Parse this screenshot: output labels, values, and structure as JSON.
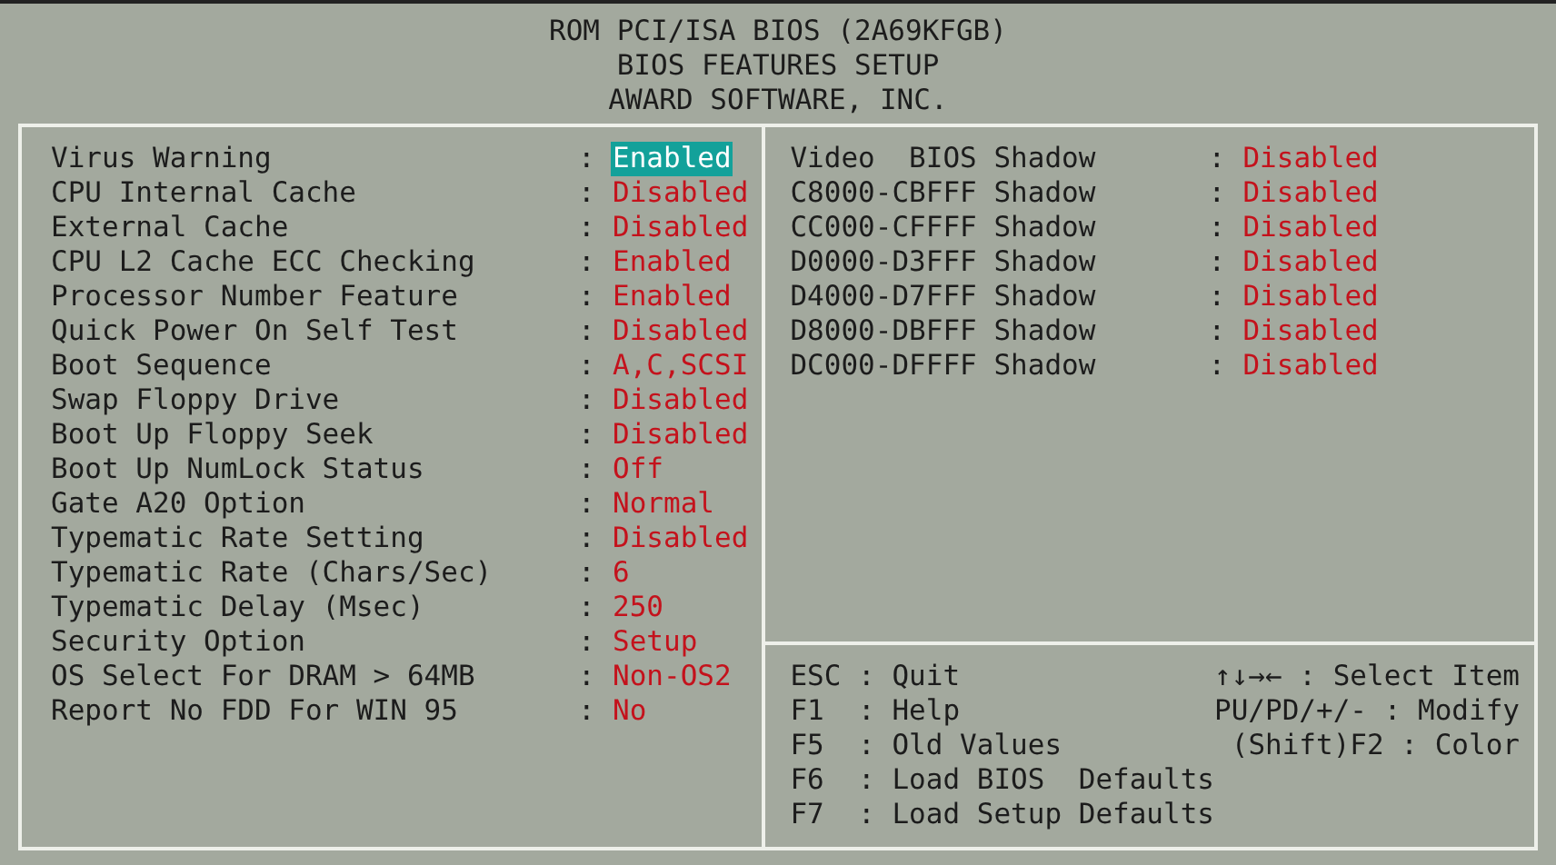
{
  "header": [
    "ROM PCI/ISA BIOS (2A69KFGB)",
    "BIOS FEATURES SETUP",
    "AWARD SOFTWARE, INC."
  ],
  "settings": [
    {
      "label": "Virus Warning",
      "separator": ":",
      "value": "Enabled",
      "selected": true
    },
    {
      "label": "CPU Internal Cache",
      "separator": ":",
      "value": "Disabled",
      "selected": false
    },
    {
      "label": "External Cache",
      "separator": ":",
      "value": "Disabled",
      "selected": false
    },
    {
      "label": "CPU L2 Cache ECC Checking",
      "separator": ":",
      "value": "Enabled",
      "selected": false
    },
    {
      "label": "Processor Number Feature",
      "separator": ":",
      "value": "Enabled",
      "selected": false
    },
    {
      "label": "Quick Power On Self Test",
      "separator": ":",
      "value": "Disabled",
      "selected": false
    },
    {
      "label": "Boot Sequence",
      "separator": ":",
      "value": "A,C,SCSI",
      "selected": false
    },
    {
      "label": "Swap Floppy Drive",
      "separator": ":",
      "value": "Disabled",
      "selected": false
    },
    {
      "label": "Boot Up Floppy Seek",
      "separator": ":",
      "value": "Disabled",
      "selected": false
    },
    {
      "label": "Boot Up NumLock Status",
      "separator": ":",
      "value": "Off",
      "selected": false
    },
    {
      "label": "Gate A20 Option",
      "separator": ":",
      "value": "Normal",
      "selected": false
    },
    {
      "label": "Typematic Rate Setting",
      "separator": ":",
      "value": "Disabled",
      "selected": false
    },
    {
      "label": "Typematic Rate (Chars/Sec)",
      "separator": ":",
      "value": "6",
      "selected": false
    },
    {
      "label": "Typematic Delay (Msec)",
      "separator": ":",
      "value": "250",
      "selected": false
    },
    {
      "label": "Security Option",
      "separator": ":",
      "value": "Setup",
      "selected": false
    },
    {
      "label": "OS Select For DRAM > 64MB",
      "separator": ":",
      "value": "Non-OS2",
      "selected": false
    },
    {
      "label": "Report No FDD For WIN 95",
      "separator": ":",
      "value": "No",
      "selected": false
    }
  ],
  "shadow_settings": [
    {
      "label": "Video  BIOS Shadow",
      "separator": ":",
      "value": "Disabled",
      "selected": false
    },
    {
      "label": "C8000-CBFFF Shadow",
      "separator": ":",
      "value": "Disabled",
      "selected": false
    },
    {
      "label": "CC000-CFFFF Shadow",
      "separator": ":",
      "value": "Disabled",
      "selected": false
    },
    {
      "label": "D0000-D3FFF Shadow",
      "separator": ":",
      "value": "Disabled",
      "selected": false
    },
    {
      "label": "D4000-D7FFF Shadow",
      "separator": ":",
      "value": "Disabled",
      "selected": false
    },
    {
      "label": "D8000-DBFFF Shadow",
      "separator": ":",
      "value": "Disabled",
      "selected": false
    },
    {
      "label": "DC000-DFFFF Shadow",
      "separator": ":",
      "value": "Disabled",
      "selected": false
    }
  ],
  "help_left": [
    "ESC : Quit",
    "F1  : Help",
    "F5  : Old Values",
    "F6  : Load BIOS  Defaults",
    "F7  : Load Setup Defaults"
  ],
  "help_right": [
    "↑↓→← : Select Item",
    "PU/PD/+/- : Modify",
    "(Shift)F2 : Color"
  ]
}
